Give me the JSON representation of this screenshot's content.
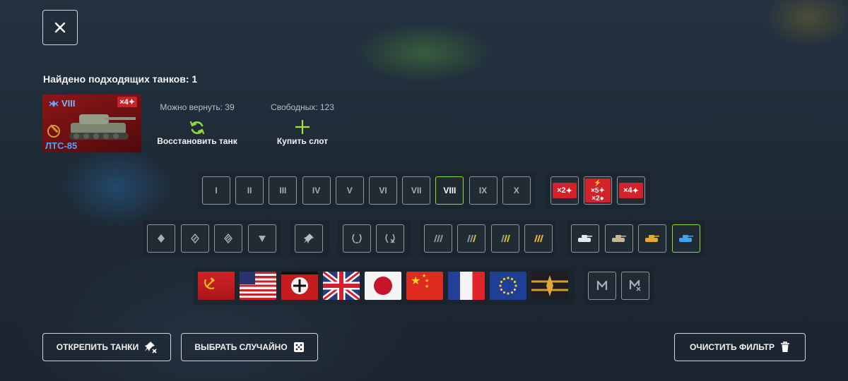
{
  "result": {
    "label": "Найдено подходящих танков: 1"
  },
  "tank": {
    "tier": "VIII",
    "multiplier": "×4",
    "name": "ЛТС-85"
  },
  "restore": {
    "label": "Можно вернуть: 39",
    "action": "Восстановить танк"
  },
  "slots": {
    "label": "Свободных: 123",
    "action": "Купить слот"
  },
  "tiers": [
    "I",
    "II",
    "III",
    "IV",
    "V",
    "VI",
    "VII",
    "VIII",
    "IX",
    "X"
  ],
  "selected_tier": "VIII",
  "multipliers": [
    "×2",
    "×5",
    "×2",
    "×4"
  ],
  "flags": [
    "ussr",
    "usa",
    "germany",
    "uk",
    "japan",
    "china",
    "france",
    "europe",
    "other"
  ],
  "bottom": {
    "unpin": "ОТКРЕПИТЬ ТАНКИ",
    "random": "ВЫБРАТЬ СЛУЧАЙНО",
    "clear": "ОЧИСТИТЬ ФИЛЬТР"
  },
  "colors": {
    "accent_green": "#8ddc3c",
    "tank_blue": "#4aa7ff",
    "multiplier_red": "#d3222a"
  }
}
